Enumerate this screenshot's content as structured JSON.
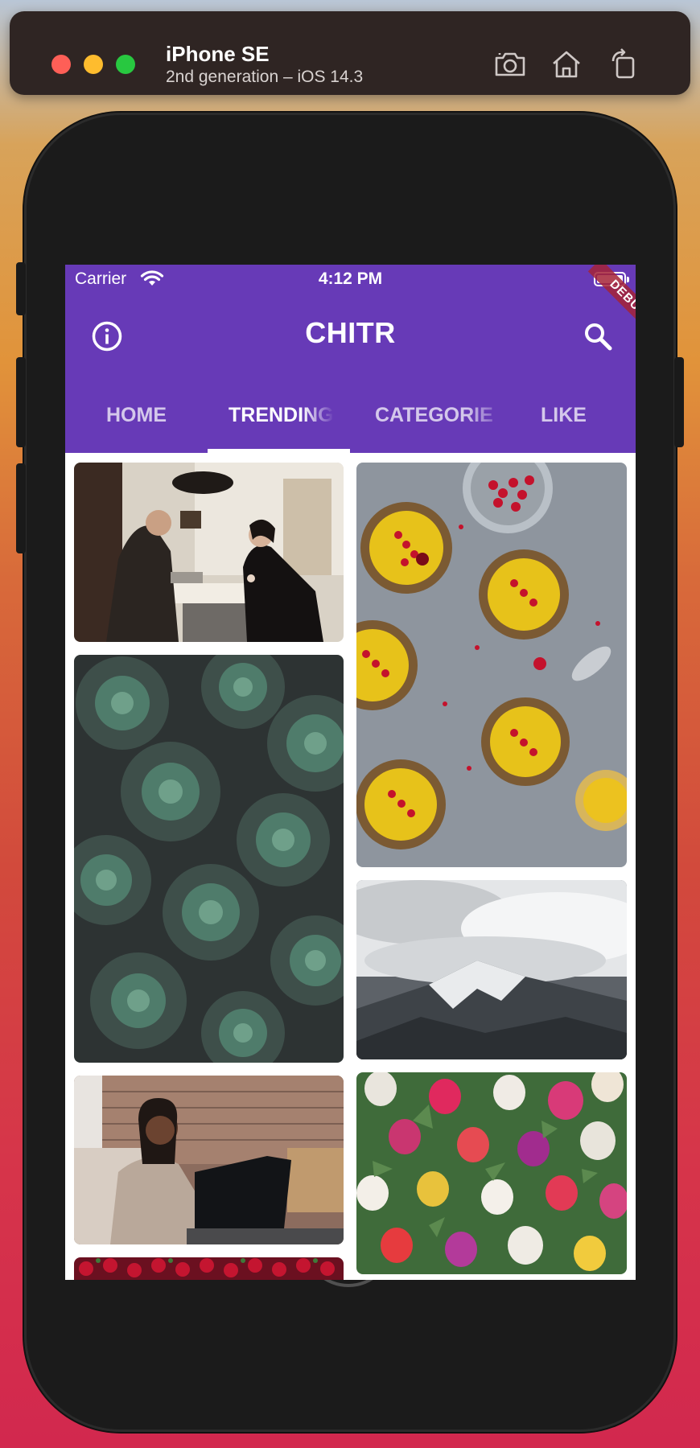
{
  "simulator": {
    "device_name": "iPhone SE",
    "device_subtitle": "2nd generation – iOS 14.3",
    "toolbar_icons": [
      "screenshot-icon",
      "home-icon",
      "rotate-icon"
    ]
  },
  "status_bar": {
    "carrier": "Carrier",
    "time": "4:12 PM"
  },
  "app_bar": {
    "title": "CHITR",
    "left_icon": "info-icon",
    "right_icon": "search-icon",
    "debug_banner": "DEBUG",
    "color": "#673ab7"
  },
  "tabs": [
    {
      "label": "HOME",
      "active": false
    },
    {
      "label": "TRENDING",
      "active": true
    },
    {
      "label": "CATEGORIES",
      "active": false
    },
    {
      "label": "LIKE",
      "active": false
    }
  ],
  "grid": {
    "images": [
      {
        "subject": "people-at-kitchen-table-photo"
      },
      {
        "subject": "fruit-tarts-photo"
      },
      {
        "subject": "succulents-photo"
      },
      {
        "subject": "snowy-mountain-photo"
      },
      {
        "subject": "woman-with-laptop-photo"
      },
      {
        "subject": "tulips-photo"
      },
      {
        "subject": "berries-photo"
      }
    ]
  }
}
